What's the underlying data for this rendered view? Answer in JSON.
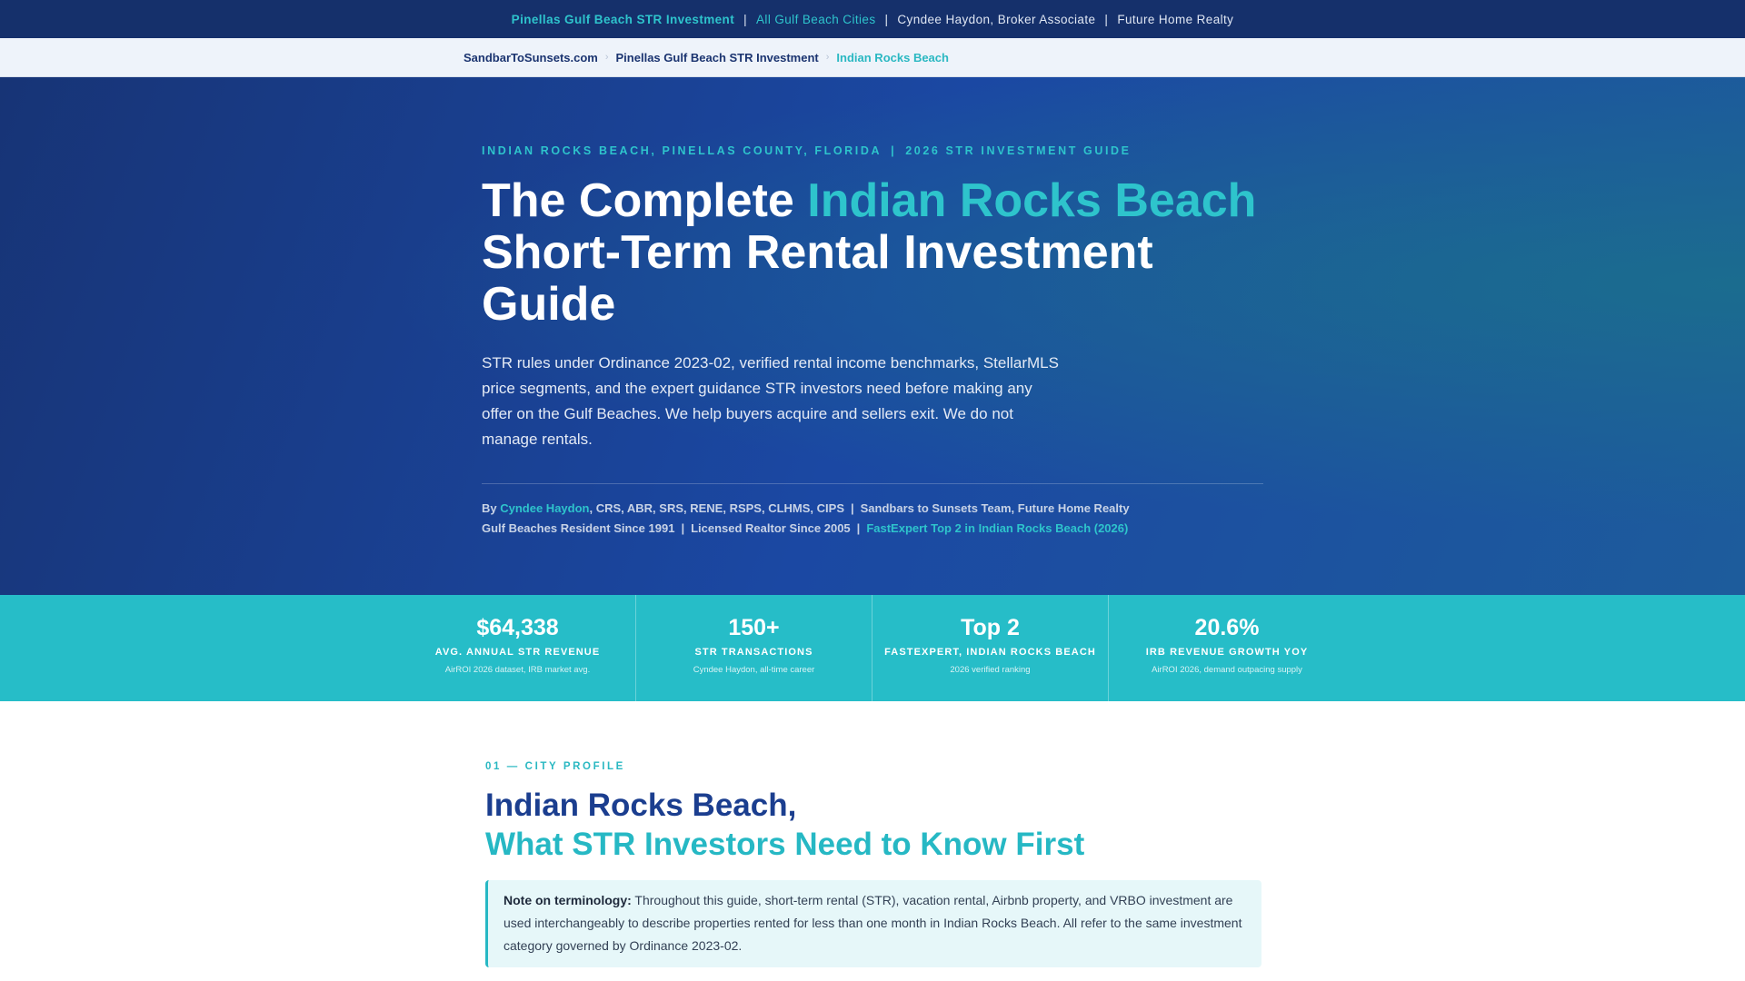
{
  "topbar": {
    "items": [
      "Pinellas Gulf Beach STR Investment",
      "All Gulf Beach Cities",
      "Cyndee Haydon, Broker Associate",
      "Future Home Realty"
    ],
    "separator": "|"
  },
  "breadcrumb": {
    "items": [
      "SandbarToSunsets.com",
      "Pinellas Gulf Beach STR Investment",
      "Indian Rocks Beach"
    ]
  },
  "hero": {
    "eyebrow_left": "INDIAN ROCKS BEACH, PINELLAS COUNTY, FLORIDA",
    "eyebrow_sep": "|",
    "eyebrow_right": "2026 STR INVESTMENT GUIDE",
    "title_pre": "The Complete ",
    "title_highlight": "Indian Rocks Beach",
    "title_post": "Short-Term Rental Investment Guide",
    "lede": "STR rules under Ordinance 2023-02, verified rental income benchmarks, StellarMLS price segments, and the expert guidance STR investors need before making any offer on the Gulf Beaches. We help buyers acquire and sellers exit. We do not manage rentals.",
    "byline": {
      "by": "By ",
      "author": "Cyndee Haydon",
      "creds": ", CRS, ABR, SRS, RENE, RSPS, CLHMS, CIPS",
      "sep": "|",
      "team": "Sandbars to Sunsets Team, Future Home Realty",
      "resident": "Gulf Beaches Resident Since 1991",
      "licensed": "Licensed Realtor Since 2005",
      "award": "FastExpert Top 2 in Indian Rocks Beach (2026)"
    }
  },
  "stats": [
    {
      "value": "$64,338",
      "label": "AVG. ANNUAL STR REVENUE",
      "source": "AirROI 2026 dataset, IRB market avg."
    },
    {
      "value": "150+",
      "label": "STR TRANSACTIONS",
      "source": "Cyndee Haydon, all-time career"
    },
    {
      "value": "Top 2",
      "label": "FASTEXPERT, INDIAN ROCKS BEACH",
      "source": "2026 verified ranking"
    },
    {
      "value": "20.6%",
      "label": "IRB REVENUE GROWTH YOY",
      "source": "AirROI 2026, demand outpacing supply"
    }
  ],
  "section1": {
    "eyebrow": "01 — CITY PROFILE",
    "title_line1": "Indian Rocks Beach,",
    "title_line2": "What STR Investors Need to Know First",
    "note_label": "Note on terminology:",
    "note_text": " Throughout this guide, short-term rental (STR), vacation rental, Airbnb property, and VRBO investment are used interchangeably to describe properties rented for less than one month in Indian Rocks Beach. All refer to the same investment category governed by Ordinance 2023-02."
  },
  "colors": {
    "navy": "#15306b",
    "teal": "#26bdc8",
    "heading_blue": "#1b3e8f"
  }
}
